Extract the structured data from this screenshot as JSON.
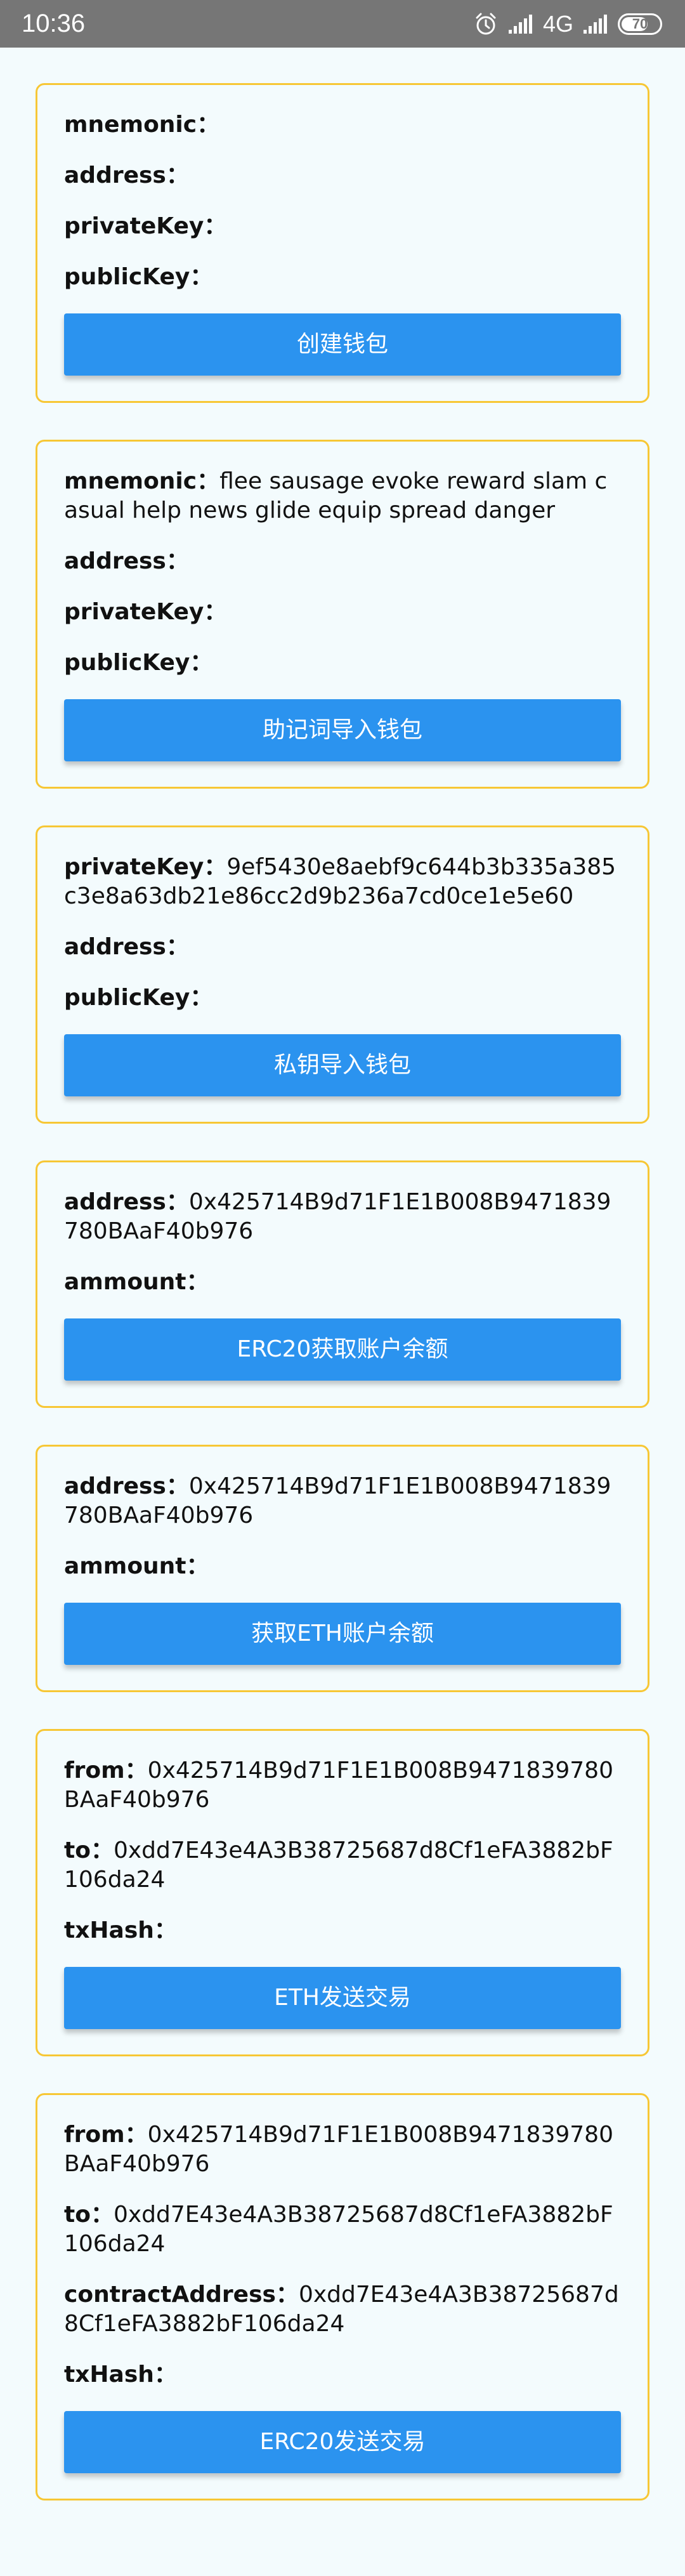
{
  "status_bar": {
    "time": "10:36",
    "network": "4G",
    "battery": "70",
    "battery_level": 0.7,
    "icons": [
      "alarm-icon",
      "signal-icon",
      "signal-icon",
      "battery-icon"
    ]
  },
  "colors": {
    "background": "#f3fbfd",
    "card_border": "#f7c735",
    "button": "#2b93ef",
    "status_bar": "#767676"
  },
  "cards": [
    {
      "fields": [
        {
          "label": "mnemonic：",
          "value": ""
        },
        {
          "label": "address：",
          "value": ""
        },
        {
          "label": "privateKey：",
          "value": ""
        },
        {
          "label": "publicKey：",
          "value": ""
        }
      ],
      "button": "创建钱包"
    },
    {
      "fields": [
        {
          "label": "mnemonic：",
          "value": "flee sausage evoke reward slam casual help news glide equip spread danger"
        },
        {
          "label": "address：",
          "value": ""
        },
        {
          "label": "privateKey：",
          "value": ""
        },
        {
          "label": "publicKey：",
          "value": ""
        }
      ],
      "button": "助记词导入钱包"
    },
    {
      "fields": [
        {
          "label": "privateKey：",
          "value": "9ef5430e8aebf9c644b3b335a385c3e8a63db21e86cc2d9b236a7cd0ce1e5e60"
        },
        {
          "label": "address：",
          "value": ""
        },
        {
          "label": "publicKey：",
          "value": ""
        }
      ],
      "button": "私钥导入钱包"
    },
    {
      "fields": [
        {
          "label": "address：",
          "value": "0x425714B9d71F1E1B008B9471839780BAaF40b976"
        },
        {
          "label": "ammount：",
          "value": ""
        }
      ],
      "button": "ERC20获取账户余额"
    },
    {
      "fields": [
        {
          "label": "address：",
          "value": "0x425714B9d71F1E1B008B9471839780BAaF40b976"
        },
        {
          "label": "ammount：",
          "value": ""
        }
      ],
      "button": "获取ETH账户余额"
    },
    {
      "fields": [
        {
          "label": "from：",
          "value": "0x425714B9d71F1E1B008B9471839780BAaF40b976"
        },
        {
          "label": "to：",
          "value": "0xdd7E43e4A3B38725687d8Cf1eFA3882bF106da24"
        },
        {
          "label": "txHash：",
          "value": ""
        }
      ],
      "button": "ETH发送交易"
    },
    {
      "fields": [
        {
          "label": "from：",
          "value": "0x425714B9d71F1E1B008B9471839780BAaF40b976"
        },
        {
          "label": "to：",
          "value": "0xdd7E43e4A3B38725687d8Cf1eFA3882bF106da24"
        },
        {
          "label": "contractAddress：",
          "value": "0xdd7E43e4A3B38725687d8Cf1eFA3882bF106da24"
        },
        {
          "label": "txHash：",
          "value": ""
        }
      ],
      "button": "ERC20发送交易"
    }
  ]
}
